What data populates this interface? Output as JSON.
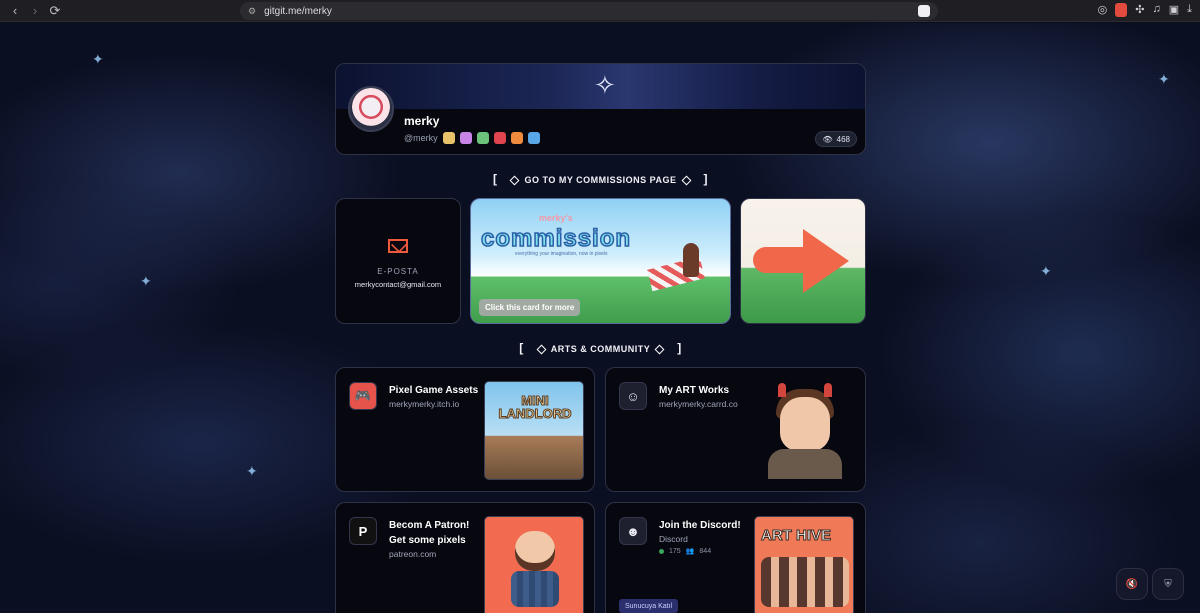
{
  "browser": {
    "url": "gitgit.me/merky"
  },
  "profile": {
    "name": "merky",
    "handle": "@merky",
    "views": "468"
  },
  "sections": {
    "commissions": "GO TO MY COMMISSIONS PAGE",
    "arts": "ARTS & COMMUNITY"
  },
  "contact": {
    "label": "E-POSTA",
    "email": "merkycontact@gmail.com"
  },
  "commission_card": {
    "small": "merky's",
    "title": "commission",
    "tagline": "everything your imagination, now in pixels",
    "cta": "Click this card for more"
  },
  "links": [
    {
      "title": "Pixel Game Assets",
      "subtitle": "merkymerky.itch.io",
      "thumb_text": "MINI LANDLORD",
      "icon": "itch-icon"
    },
    {
      "title": "My ART Works",
      "subtitle": "merkymerky.carrd.co",
      "icon": "avatar-icon"
    },
    {
      "title": "Becom A Patron! Get some pixels",
      "subtitle": "patreon.com",
      "icon": "patreon-icon"
    },
    {
      "title": "Join the Discord!",
      "subtitle": "Discord",
      "online": "175",
      "members": "844",
      "host_badge": "Sunucuya Katıl",
      "thumb_text": "ART HIVE",
      "icon": "discord-server-icon"
    }
  ],
  "colors": {
    "accent": "#ef5a3c",
    "card_bg": "#06070f",
    "border": "#2e3246"
  }
}
